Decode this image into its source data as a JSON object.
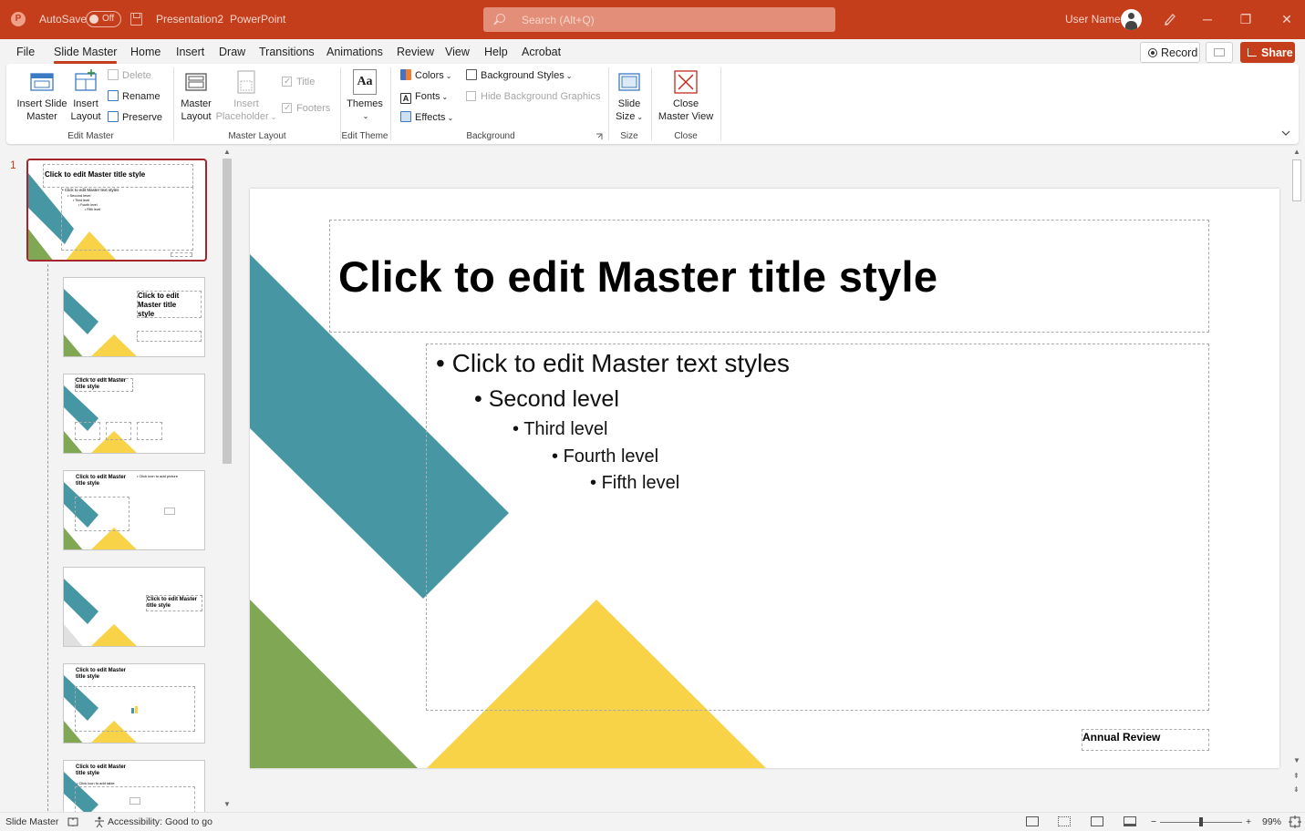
{
  "titlebar": {
    "autosave_label": "AutoSave",
    "autosave_state": "Off",
    "document_title": "Presentation2",
    "separator": "-",
    "app_name": "PowerPoint",
    "search_placeholder": "Search (Alt+Q)",
    "user_name": "User Name",
    "minimize": "─",
    "restore": "❐",
    "close": "✕"
  },
  "tabs": [
    "File",
    "Slide Master",
    "Home",
    "Insert",
    "Draw",
    "Transitions",
    "Animations",
    "Review",
    "View",
    "Help",
    "Acrobat"
  ],
  "active_tab": "Slide Master",
  "actions": {
    "record": "Record",
    "share": "Share"
  },
  "ribbon": {
    "edit_master": {
      "label": "Edit Master",
      "insert_slide_master": [
        "Insert Slide",
        "Master"
      ],
      "insert_layout": [
        "Insert",
        "Layout"
      ],
      "delete": "Delete",
      "rename": "Rename",
      "preserve": "Preserve"
    },
    "master_layout": {
      "label": "Master Layout",
      "master_layout_btn": [
        "Master",
        "Layout"
      ],
      "insert_placeholder": [
        "Insert",
        "Placeholder"
      ],
      "title": "Title",
      "footers": "Footers"
    },
    "edit_theme": {
      "label": "Edit Theme",
      "themes": "Themes",
      "themes_glyph": "Aa"
    },
    "background": {
      "label": "Background",
      "colors": "Colors",
      "fonts": "Fonts",
      "fonts_glyph": "A",
      "effects": "Effects",
      "background_styles": "Background Styles",
      "hide_background_graphics": "Hide Background Graphics"
    },
    "size": {
      "label": "Size",
      "slide_size": [
        "Slide",
        "Size"
      ]
    },
    "close": {
      "label": "Close",
      "close_master_view": [
        "Close",
        "Master View"
      ]
    }
  },
  "thumbnails": {
    "master_number": "1",
    "master": {
      "title": "Click to edit Master title style",
      "levels": [
        "• Click to edit Master text styles",
        "• Second level",
        "• Third level",
        "• Fourth level",
        "• Fifth level"
      ]
    },
    "layouts": [
      {
        "title": "Click to edit Master title style"
      },
      {
        "title": "Click to edit Master title style"
      },
      {
        "title": "Click to edit Master title style",
        "extra": "• Click icon to add picture"
      },
      {
        "title": "Click to edit Master title style"
      },
      {
        "title": "Click to edit Master title style"
      },
      {
        "title": "Click to edit Master title style",
        "extra": "• Click icon to add table"
      }
    ]
  },
  "slide": {
    "title": "Click to edit Master title style",
    "levels": [
      {
        "text": "Click to edit Master text styles"
      },
      {
        "text": "Second level"
      },
      {
        "text": "Third level"
      },
      {
        "text": "Fourth level"
      },
      {
        "text": "Fifth level"
      }
    ],
    "footer": "Annual Review",
    "bullet": "•"
  },
  "colors": {
    "accent": "#c43e1c",
    "teal": "#4796a4",
    "green": "#80a753",
    "yellow": "#f8d347",
    "selected_border": "#a4262c"
  },
  "statusbar": {
    "view_name": "Slide Master",
    "accessibility": "Accessibility: Good to go",
    "zoom": "99%",
    "zoom_minus": "−",
    "zoom_plus": "+"
  }
}
